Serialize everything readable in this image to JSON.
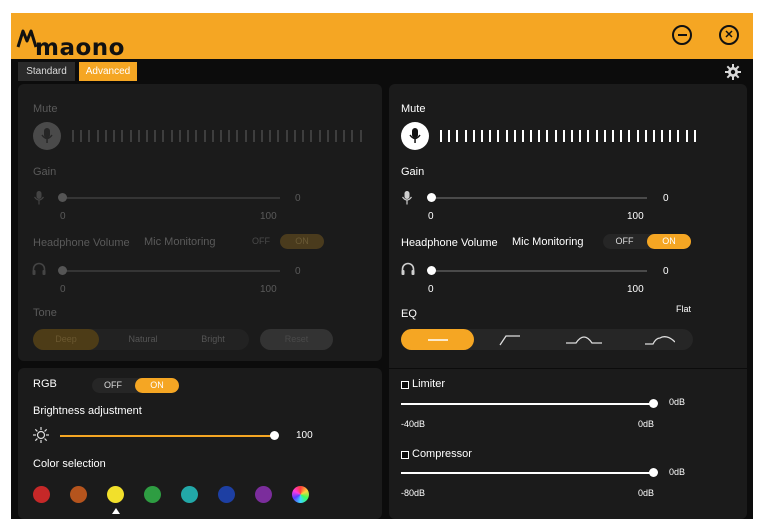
{
  "brand": {
    "name": "maono",
    "accent": "#f5a623"
  },
  "window": {
    "minimize_icon": "minus-circle-icon",
    "close_icon": "close-circle-icon"
  },
  "tabs": [
    {
      "label": "Standard",
      "active": false
    },
    {
      "label": "Advanced",
      "active": true
    }
  ],
  "settings_icon": "gear-icon",
  "left": {
    "mute_label": "Mute",
    "gain_label": "Gain",
    "gain": {
      "min": "0",
      "max": "100",
      "value": "0"
    },
    "headphone_label": "Headphone Volume",
    "mic_monitoring_label": "Mic Monitoring",
    "mic_monitoring": {
      "off": "OFF",
      "on": "ON"
    },
    "headphone": {
      "min": "0",
      "max": "100",
      "value": "0"
    },
    "tone_label": "Tone",
    "tone_options": [
      "Deep",
      "Natural",
      "Bright"
    ],
    "reset_label": "Reset"
  },
  "rgb": {
    "label": "RGB",
    "toggle": {
      "off": "OFF",
      "on": "ON",
      "state": "on"
    },
    "brightness_label": "Brightness adjustment",
    "brightness": {
      "value": "100",
      "fraction": 1.0
    },
    "color_label": "Color selection",
    "colors": [
      "#c62828",
      "#b5541d",
      "#f2e02b",
      "#2e9d42",
      "#22a8a8",
      "#1d3fa3",
      "#7b2d9c",
      "rainbow"
    ],
    "selected_index": 2
  },
  "right": {
    "mute_label": "Mute",
    "gain_label": "Gain",
    "gain": {
      "min": "0",
      "max": "100",
      "value": "0"
    },
    "headphone_label": "Headphone Volume",
    "mic_monitoring_label": "Mic Monitoring",
    "mic_monitoring": {
      "off": "OFF",
      "on": "ON",
      "state": "on"
    },
    "headphone": {
      "min": "0",
      "max": "100",
      "value": "0"
    },
    "eq_label": "EQ",
    "eq_preset": "Flat",
    "eq_icons": [
      "flat-eq-icon",
      "low-cut-eq-icon",
      "mid-boost-eq-icon",
      "presence-eq-icon"
    ],
    "limiter": {
      "label": "Limiter",
      "value": "0dB",
      "min": "-40dB",
      "max": "0dB",
      "fraction": 1.0
    },
    "compressor": {
      "label": "Compressor",
      "value": "0dB",
      "min": "-80dB",
      "max": "0dB",
      "fraction": 1.0
    }
  }
}
